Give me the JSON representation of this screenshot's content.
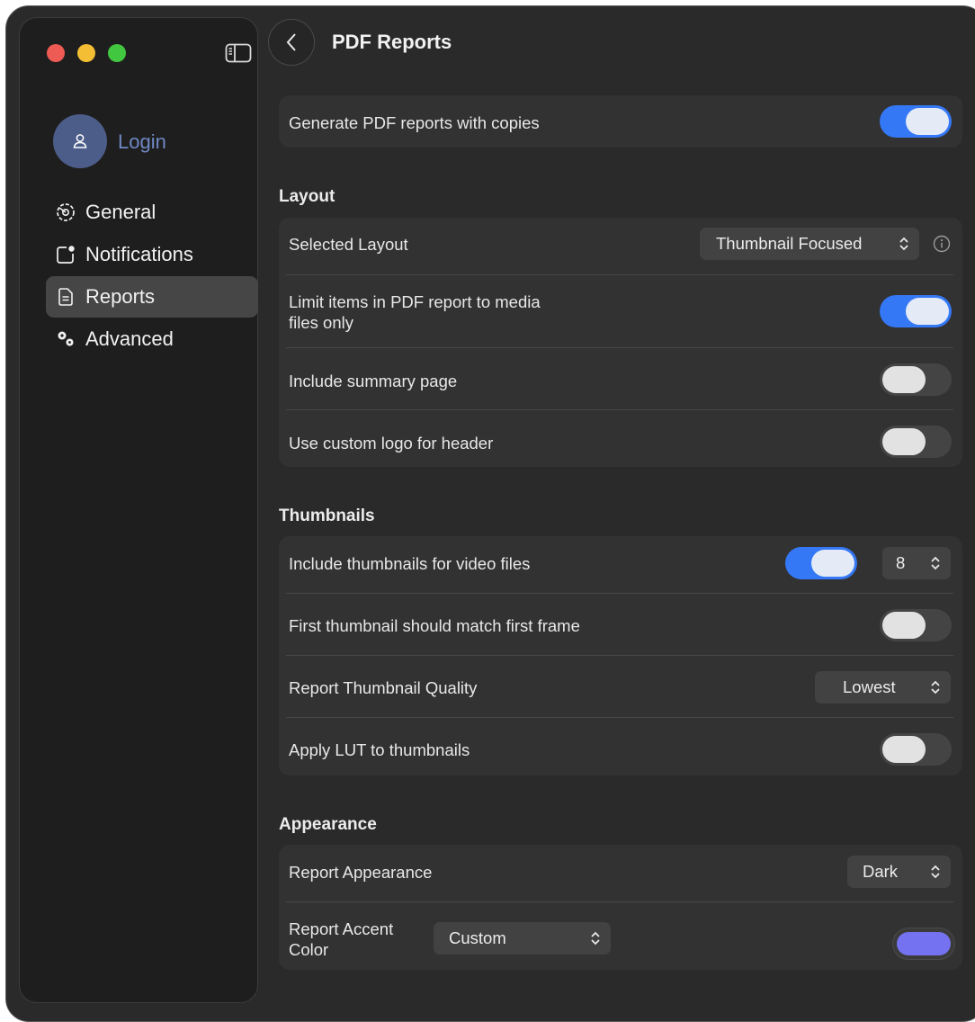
{
  "window": {
    "title": "PDF Reports"
  },
  "sidebar": {
    "login_label": "Login",
    "items": [
      {
        "label": "General",
        "icon": "gear-badge-icon",
        "active": false
      },
      {
        "label": "Notifications",
        "icon": "notification-badge-icon",
        "active": false
      },
      {
        "label": "Reports",
        "icon": "document-icon",
        "active": true
      },
      {
        "label": "Advanced",
        "icon": "gears-icon",
        "active": false
      }
    ]
  },
  "general": {
    "generate_pdf_label": "Generate PDF reports with copies",
    "generate_pdf_on": true
  },
  "layout": {
    "heading": "Layout",
    "selected_layout_label": "Selected Layout",
    "selected_layout_value": "Thumbnail Focused",
    "limit_items_label_line1": "Limit items in PDF report to media",
    "limit_items_label_line2": "files only",
    "limit_items_on": true,
    "include_summary_label": "Include summary page",
    "include_summary_on": false,
    "custom_logo_label": "Use custom logo for header",
    "custom_logo_on": false
  },
  "thumbnails": {
    "heading": "Thumbnails",
    "include_video_label": "Include thumbnails for video files",
    "include_video_on": true,
    "video_count_value": "8",
    "first_frame_label": "First thumbnail should match first frame",
    "first_frame_on": false,
    "quality_label": "Report Thumbnail Quality",
    "quality_value": "Lowest",
    "apply_lut_label": "Apply LUT to thumbnails",
    "apply_lut_on": false
  },
  "appearance": {
    "heading": "Appearance",
    "report_appearance_label": "Report Appearance",
    "report_appearance_value": "Dark",
    "accent_label_line1": "Report Accent",
    "accent_label_line2": "Color",
    "accent_value": "Custom",
    "accent_color": "#7472f0"
  },
  "colors": {
    "accent_blue": "#3478f6",
    "window_bg": "#2a2a2a",
    "sidebar_bg": "#1e1e1e",
    "login_text": "#6f88c4"
  }
}
